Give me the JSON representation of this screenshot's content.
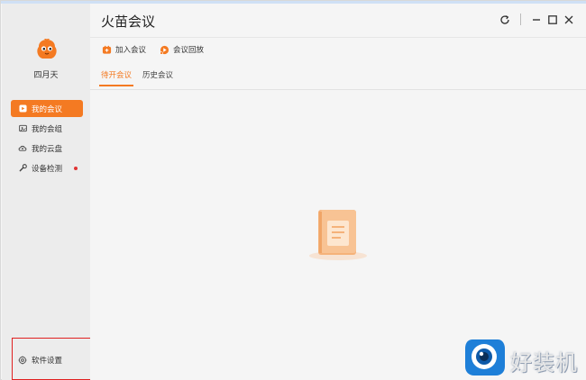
{
  "app": {
    "title": "火苗会议"
  },
  "user": {
    "name": "四月天"
  },
  "sidebar": {
    "items": [
      {
        "label": "我的会议",
        "icon": "meeting-icon",
        "active": true
      },
      {
        "label": "我的会组",
        "icon": "group-icon",
        "active": false
      },
      {
        "label": "我的云盘",
        "icon": "cloud-icon",
        "active": false
      },
      {
        "label": "设备检测",
        "icon": "wrench-icon",
        "active": false,
        "badge_dot": true
      }
    ],
    "settings": {
      "label": "软件设置",
      "icon": "gear-icon"
    }
  },
  "toolbar": {
    "actions": [
      {
        "label": "加入会议",
        "icon": "join-meeting-icon"
      },
      {
        "label": "会议回放",
        "icon": "playback-icon"
      }
    ]
  },
  "tabs": [
    {
      "label": "待开会议",
      "active": true
    },
    {
      "label": "历史会议",
      "active": false
    }
  ],
  "window_controls": [
    "refresh-icon",
    "minimize-icon",
    "maximize-icon",
    "close-icon"
  ],
  "colors": {
    "accent": "#f47a22",
    "sidebar_bg": "#ececec",
    "main_bg": "#f5f5f5",
    "highlight_box": "#e02020"
  },
  "watermark": {
    "text": "好装机"
  }
}
